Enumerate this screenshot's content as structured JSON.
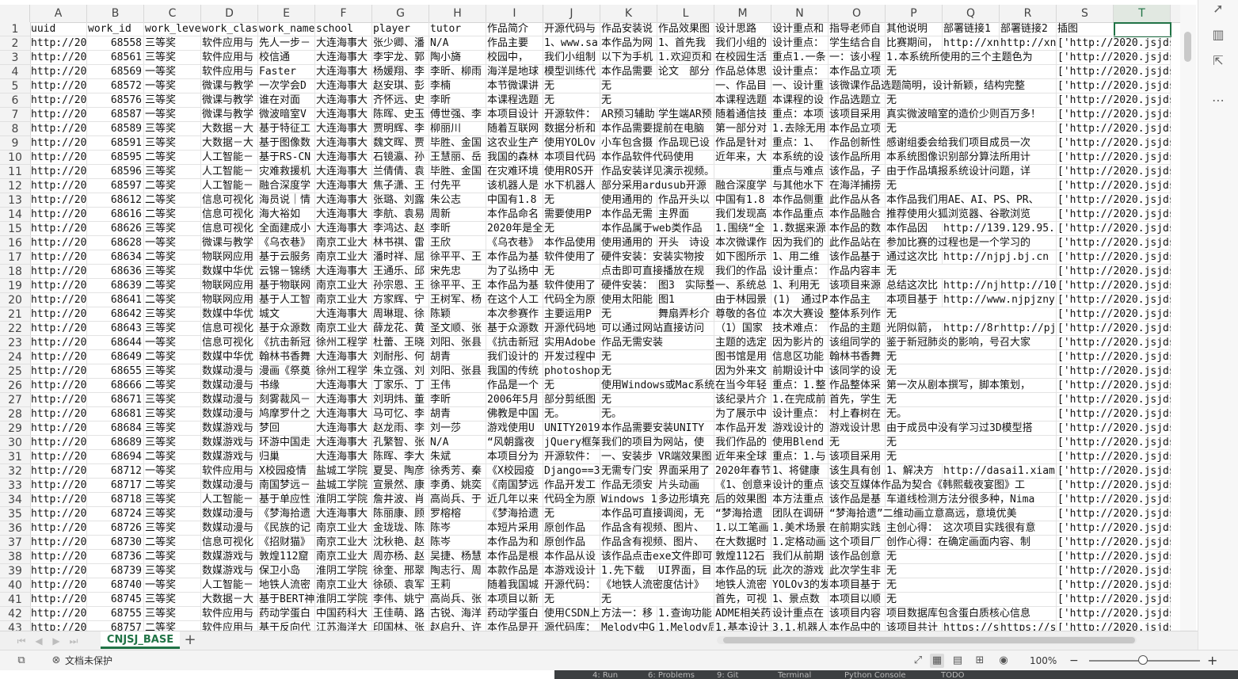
{
  "columns": [
    "A",
    "B",
    "C",
    "D",
    "E",
    "F",
    "G",
    "H",
    "I",
    "J",
    "K",
    "L",
    "M",
    "N",
    "O",
    "P",
    "Q",
    "R",
    "S",
    "T"
  ],
  "selected_column": "T",
  "row_numbers": [
    "1",
    "2",
    "3",
    "4",
    "5",
    "6",
    "7",
    "8",
    "9",
    "10",
    "11",
    "12",
    "13",
    "14",
    "15",
    "16",
    "17",
    "18",
    "19",
    "20",
    "21",
    "22",
    "23",
    "24",
    "25",
    "26",
    "27",
    "28",
    "29",
    "30",
    "31",
    "32",
    "33",
    "34",
    "35",
    "36",
    "37",
    "38",
    "39",
    "40",
    "41",
    "42",
    "43"
  ],
  "rows": [
    [
      "uuid",
      "work_id",
      "work_leve",
      "work_clas",
      "work_name",
      "school",
      "player",
      "tutor",
      "作品简介",
      "开源代码与",
      "作品安装说",
      "作品效果图",
      "设计思路",
      "设计重点和",
      "指导老师自",
      "其他说明",
      "部署链接1",
      "部署链接2",
      "插图",
      ""
    ],
    [
      "http://20",
      "68558",
      "三等奖",
      "软件应用与",
      "先人一步－",
      "大连海事大",
      "张少卿、潘",
      "N/A",
      "作品主要",
      "1、www.sa",
      "本作品为网",
      "1、首先我",
      "我们小组的",
      "设计重点：",
      "学生结合自",
      "比赛期间，",
      "http://xn",
      "http://xn",
      "['http://2020.jsjds.",
      ""
    ],
    [
      "http://20",
      "68561",
      "三等奖",
      "软件应用与",
      "校信通",
      "大连海事大",
      "李宇龙、郭",
      "陶小旖",
      "校园中，",
      "我们小组制",
      "以下为手机",
      "1.欢迎页和",
      "在校园生活",
      "重点1.一条",
      "一：该小程",
      "1.本系统所使用的三个主题色为",
      "",
      "",
      "['http://2020.jsjds.",
      ""
    ],
    [
      "http://20",
      "68569",
      "一等奖",
      "软件应用与",
      "Faster",
      "大连海事大",
      "杨媛翔、李",
      "李昕、柳雨",
      "海洋是地球",
      "模型训练代",
      "本作品需要",
      "论文　部分",
      "作品总体思",
      "设计重点：",
      "本作品立项",
      "无",
      "",
      "",
      "['http://2020.jsjds.",
      ""
    ],
    [
      "http://20",
      "68572",
      "一等奖",
      "微课与教学",
      "一次学会D",
      "大连海事大",
      "赵安琪、彭",
      "李楠",
      "本节微课讲",
      "无",
      "无",
      "",
      "一、作品目",
      "一、设计重",
      "该微课作品选题简明，设计新颖，结构完整",
      "",
      "",
      "",
      "['http://2020.jsjds.",
      ""
    ],
    [
      "http://20",
      "68576",
      "三等奖",
      "微课与教学",
      "谁在对面",
      "大连海事大",
      "齐怀远、史",
      "李昕",
      "本课程选题",
      "无",
      "无",
      "",
      "本课程选题",
      "本课程的设",
      "作品选题立",
      "无",
      "",
      "",
      "['http://2020.jsjds.",
      ""
    ],
    [
      "http://20",
      "68587",
      "一等奖",
      "微课与教学",
      "微波暗室V",
      "大连海事大",
      "陈晖、史玉",
      "傅世强、李",
      "本项目设计",
      "开源软件：",
      "AR预习辅助",
      "学生端AR预",
      "随着通信技",
      "重点：本项",
      "该项目采用",
      "真实微波暗室的造价少则百万多！",
      "",
      "",
      "['http://2020.jsjds.",
      ""
    ],
    [
      "http://20",
      "68589",
      "三等奖",
      "大数据－大",
      "基于特征工",
      "大连海事大",
      "贾明辉、李",
      "柳丽川",
      "随着互联网",
      "数据分析和",
      "本作品需要提前在电脑",
      "",
      "第一部分对",
      "1.去除无用",
      "本作品立项",
      "无",
      "",
      "",
      "['http://2020.jsjds.",
      ""
    ],
    [
      "http://20",
      "68591",
      "三等奖",
      "大数据－大",
      "基于图像数",
      "大连海事大",
      "魏文晖、贾",
      "毕胜、金国",
      "这农业生产",
      "使用YOLOv",
      "小车包含摄",
      "作品现已设",
      "作品是针对",
      "重点：1、",
      "作品创新性",
      "感谢组委会给我们项目成员一次",
      "",
      "",
      "['http://2020.jsjds.",
      ""
    ],
    [
      "http://20",
      "68595",
      "二等奖",
      "人工智能－",
      "基于RS-CN",
      "大连海事大",
      "石镜瀛、孙",
      "王慧丽、岳",
      "我国的森林",
      "本项目代码",
      "本作品软件代码使用",
      "",
      "近年来，大",
      "本系统的设",
      "该作品所用",
      "本系统图像识别部分算法所用计",
      "",
      "",
      "['http://2020.jsjds.",
      ""
    ],
    [
      "http://20",
      "68596",
      "三等奖",
      "人工智能－",
      "灾难救援机",
      "大连海事大",
      "兰倩倩、袁",
      "毕胜、金国",
      "在灾难环境",
      "使用ROS开",
      "作品安装详见演示视频。",
      "",
      "",
      "重点与难点",
      "该作品，子",
      "由于作品填报系统设计问题，详",
      "",
      "",
      "['http://2020.jsjds.",
      ""
    ],
    [
      "http://20",
      "68597",
      "二等奖",
      "人工智能－",
      "融合深度学",
      "大连海事大",
      "焦子潇、王",
      "付先平",
      "该机器人是",
      "水下机器人",
      "部分采用ardusub开源",
      "",
      "融合深度学",
      "与其他水下",
      "在海洋捕捞",
      "无",
      "",
      "",
      "['http://2020.jsjds.",
      ""
    ],
    [
      "http://20",
      "68612",
      "二等奖",
      "信息可视化",
      "海员说｜情",
      "大连海事大",
      "张璐、刘露",
      "朱公志",
      "中国有1.8",
      "无",
      "使用通用的",
      "作品开头以",
      "中国有1.8",
      "本作品侧重",
      "此作品从各",
      "本作品我们用AE、AI、PS、PR、",
      "",
      "",
      "['http://2020.jsjds.",
      ""
    ],
    [
      "http://20",
      "68616",
      "二等奖",
      "信息可视化",
      "海大裕如",
      "大连海事大",
      "李航、袁易",
      "周新",
      "本作品命名",
      "需要使用P",
      "本作品无需",
      "主界面",
      "我们发现高",
      "本作品重点",
      "本作品融合",
      "推荐使用火狐浏览器、谷歌浏览",
      "",
      "",
      "['http://2020.jsjds.",
      ""
    ],
    [
      "http://20",
      "68626",
      "三等奖",
      "信息可视化",
      "全面建成小",
      "大连海事大",
      "李鸿达、赵",
      "李昕",
      "2020年是全",
      "无",
      "本作品属于web类作品",
      "",
      "1.围绕“全",
      "1.数据来源",
      "本作品的数",
      "本作品因",
      "http://139.129.95.",
      "",
      "['http://2020.jsjds.",
      ""
    ],
    [
      "http://20",
      "68628",
      "一等奖",
      "微课与教学",
      "《乌衣巷》",
      "南京工业大",
      "林书祺、雷",
      "王欣",
      "《乌衣巷》",
      "本作品使用",
      "使用通用的",
      "开头　诗设",
      "本次微课作",
      "因为我们的",
      "此作品站在",
      "参加比赛的过程也是一个学习的",
      "",
      "",
      "['http://2020.jsjds.",
      ""
    ],
    [
      "http://20",
      "68634",
      "二等奖",
      "物联网应用",
      "基于云服务",
      "南京工业大",
      "潘时祥、屈",
      "徐平平、王",
      "本作品为基",
      "软件使用了",
      "硬件安装：安装实物按",
      "",
      "如下图所示",
      "1、用二维",
      "该作品基于",
      "通过这次比",
      "http://njpj.bj.cn",
      "",
      "['http://2020.jsjds.",
      ""
    ],
    [
      "http://20",
      "68636",
      "三等奖",
      "数媒中华优",
      "云锦－锦绣",
      "大连海事大",
      "王通乐、邱",
      "宋先忠",
      "为了弘扬中",
      "无",
      "点击即可直接播放在规",
      "",
      "我们的作品",
      "设计重点：",
      "作品内容丰",
      "无",
      "",
      "",
      "['http://2020.jsjds.",
      ""
    ],
    [
      "http://20",
      "68639",
      "二等奖",
      "物联网应用",
      "基于物联网",
      "南京工业大",
      "孙宗恩、王",
      "徐平平、王",
      "本作品为基",
      "软件使用了",
      "硬件安装：",
      "图3　实际整",
      "一、系统总",
      "1、利用无",
      "该项目来源",
      "总结这次比",
      "http://nj",
      "http://10",
      "['http://2020.jsjds.",
      ""
    ],
    [
      "http://20",
      "68641",
      "二等奖",
      "物联网应用",
      "基于人工智",
      "南京工业大",
      "方家辉、宁",
      "王树军、杨",
      "在这个人工",
      "代码全为原",
      "使用太阳能",
      "图1",
      "由于林园景",
      "(1)　通过P",
      "本作品主",
      "本项目基于",
      "http://www.njpjzny",
      "",
      "['http://2020.jsjds.",
      ""
    ],
    [
      "http://20",
      "68642",
      "三等奖",
      "数媒中华优",
      "城文",
      "大连海事大",
      "周琳琨、徐",
      "陈颖",
      "本次参赛作",
      "主要运用P",
      "无",
      "舞扇弄杉介",
      "尊敬的各位",
      "本次大赛设",
      "整体系列作",
      "无",
      "",
      "",
      "['http://2020.jsjds.",
      ""
    ],
    [
      "http://20",
      "68643",
      "三等奖",
      "信息可视化",
      "基于众源数",
      "南京工业大",
      "薛龙花、黄",
      "圣文顺、张",
      "基于众源数",
      "开源代码地",
      "可以通过网站直接访问",
      "",
      "（1）国家",
      "技术难点：",
      "作品的主题",
      "光阴似箭，",
      "http://8r",
      "http://pj",
      "['http://2020.jsjds.",
      ""
    ],
    [
      "http://20",
      "68644",
      "一等奖",
      "信息可视化",
      "《抗击新冠",
      "徐州工程学",
      "杜蕾、王晓",
      "刘阳、张县",
      "《抗击新冠",
      "实用Adobe",
      "作品无需安装",
      "",
      "主题的选定",
      "因为影片的",
      "该组同学的",
      "鉴于新冠肺炎的影响，号召大家",
      "",
      "",
      "['http://2020.jsjds.",
      ""
    ],
    [
      "http://20",
      "68649",
      "二等奖",
      "数媒中华优",
      "翰林书香舞",
      "大连海事大",
      "刘耐彤、何",
      "胡青",
      "我们设计的",
      "开发过程中",
      "无",
      "",
      "图书馆是用",
      "信息区功能",
      "翰林书香舞",
      "无",
      "",
      "",
      "['http://2020.jsjds.",
      ""
    ],
    [
      "http://20",
      "68655",
      "三等奖",
      "数媒动漫与",
      "漫画《祭奠",
      "徐州工程学",
      "朱立强、刘",
      "刘阳、张县",
      "我国的传统",
      "photoshop",
      "无",
      "",
      "因为外来文",
      "前期设计中",
      "该同学的设",
      "无",
      "",
      "",
      "['http://2020.jsjds.",
      ""
    ],
    [
      "http://20",
      "68666",
      "二等奖",
      "数媒动漫与",
      "书缘",
      "大连海事大",
      "丁家乐、丁",
      "王伟",
      "作品是一个",
      "无",
      "使用Windows或Mac系统",
      "",
      "在当今年轻",
      "重点：1.整",
      "作品整体采",
      "第一次从剧本撰写，脚本策划，",
      "",
      "",
      "['http://2020.jsjds.",
      ""
    ],
    [
      "http://20",
      "68671",
      "三等奖",
      "数媒动漫与",
      "刻雾裁风－",
      "大连海事大",
      "刘玥炜、董",
      "李昕",
      "2006年5月",
      "部分剪纸图",
      "无",
      "",
      "该纪录片介",
      "1.在完成前",
      "首先，学生",
      "无",
      "",
      "",
      "['http://2020.jsjds.",
      ""
    ],
    [
      "http://20",
      "68681",
      "三等奖",
      "数媒动漫与",
      "鸠摩罗什之",
      "大连海事大",
      "马可忆、李",
      "胡青",
      "佛教是中国",
      "无。",
      "无。",
      "",
      "为了展示中",
      "设计重点：",
      "村上春树在",
      "无。",
      "",
      "",
      "['http://2020.jsjds.",
      ""
    ],
    [
      "http://20",
      "68684",
      "三等奖",
      "数媒游戏与",
      "梦回",
      "大连海事大",
      "赵龙雨、李",
      "刘一莎",
      "游戏使用U",
      "UNITY2019",
      "本作品需要安装UNITY",
      "",
      "本作品开发",
      "游戏设计的",
      "游戏设计思",
      "由于成员中没有学习过3D模型搭",
      "",
      "",
      "['http://2020.jsjds.",
      ""
    ],
    [
      "http://20",
      "68689",
      "三等奖",
      "数媒游戏与",
      "环游中国走",
      "大连海事大",
      "孔繁智、张",
      "N/A",
      "“风朝露夜",
      "jQuery框架",
      "我们的项目为网站，使",
      "",
      "我们作品的",
      "使用Blend",
      "无",
      "无",
      "",
      "",
      "['http://2020.jsjds.",
      ""
    ],
    [
      "http://20",
      "68694",
      "二等奖",
      "数媒游戏与",
      "归巢",
      "大连海事大",
      "陈晖、李大",
      "朱斌",
      "本项目分为",
      "开源软件：",
      "一、安装步",
      "VR端效果图",
      "近年来全球",
      "重点：1.与",
      "该项目采用",
      "无",
      "",
      "",
      "['http://2020.jsjds.",
      ""
    ],
    [
      "http://20",
      "68712",
      "一等奖",
      "软件应用与",
      "X校园疫情",
      "盐城工学院",
      "夏旻、陶彦",
      "徐秀芳、秦",
      "《X校园疫",
      "Django==3",
      "无需专门安",
      "界面采用了",
      "2020年春节",
      "1、将健康",
      "该生具有创",
      "1、解决方",
      "http://dasai1.xiam",
      "",
      "['http://2020.jsjds.",
      ""
    ],
    [
      "http://20",
      "68717",
      "二等奖",
      "数媒动漫与",
      "南国梦远－",
      "盐城工学院",
      "宣景然、康",
      "李勇、姚奕",
      "《南国梦远",
      "作品开发工",
      "作品无须安",
      "片头动画",
      "《1、创意来",
      "设计的重点",
      "该交互媒体作品为契合《韩熙载夜宴图》工",
      "",
      "",
      "",
      "['http://2020.jsjds.",
      ""
    ],
    [
      "http://20",
      "68718",
      "三等奖",
      "人工智能－",
      "基于单应性",
      "淮阴工学院",
      "詹井波、肖",
      "高尚兵、于",
      "近几年以来",
      "代码全为原",
      "Windows 1",
      "多边形填充",
      "后的效果图",
      "本方法重点",
      "该作品是基",
      "车道线检测方法分很多种，Nima",
      "",
      "",
      "['http://2020.jsjds.",
      ""
    ],
    [
      "http://20",
      "68724",
      "三等奖",
      "数媒动漫与",
      "《梦海拾遗",
      "大连海事大",
      "陈丽康、顾",
      "罗榕榕",
      "《梦海拾遗",
      "无",
      "本作品可直接调阅，无",
      "",
      "“梦海拾遗",
      "团队在调研",
      "“梦海拾遗”二维动画立意高远，意境优美",
      "",
      "",
      "",
      "['http://2020.jsjds.",
      ""
    ],
    [
      "http://20",
      "68726",
      "三等奖",
      "数媒动漫与",
      "《民族的记",
      "南京工业大",
      "金珑珑、陈",
      "陈岑",
      "本短片采用",
      "原创作品",
      "作品含有视频、图片、",
      "",
      "1.以工笔画",
      "1.美术场景",
      "在前期实践",
      "主创心得：　这次项目实践很有意",
      "",
      "",
      "['http://2020.jsjds.",
      ""
    ],
    [
      "http://20",
      "68730",
      "二等奖",
      "信息可视化",
      "《招财猫》",
      "南京工业大",
      "沈秋艳、赵",
      "陈岑",
      "本作品为和",
      "原创作品",
      "作品含有视频、图片、",
      "",
      "在大数据时",
      "1.定格动画",
      "这个项目厂",
      "创作心得：在确定画面内容、制",
      "",
      "",
      "['http://2020.jsjds.",
      ""
    ],
    [
      "http://20",
      "68736",
      "二等奖",
      "数媒游戏与",
      "敦煌112窟",
      "南京工业大",
      "周亦杨、赵",
      "吴捷、杨慧",
      "本作品是根",
      "本作品从设",
      "该作品点击exe文件即可",
      "",
      "敦煌112石",
      "我们从前期",
      "该作品创意",
      "无",
      "",
      "",
      "['http://2020.jsjds.",
      ""
    ],
    [
      "http://20",
      "68739",
      "三等奖",
      "数媒游戏与",
      "保卫小岛",
      "淮阴工学院",
      "徐奎、邢翠",
      "陶志行、周",
      "本款作品是",
      "本游戏设计",
      "1.先下载",
      "UI界面，目",
      "本作品的玩",
      "此次的游戏",
      "此次学生非",
      "无",
      "",
      "",
      "['http://2020.jsjds.",
      ""
    ],
    [
      "http://20",
      "68740",
      "一等奖",
      "人工智能－",
      "地铁人流密",
      "南京工业大",
      "徐硕、袁军",
      "王莉",
      "随着我国城",
      "开源代码：",
      "《地铁人流密度估计》",
      "",
      "地铁人流密",
      "YOLOv3的发",
      "本项目基于",
      "无",
      "",
      "",
      "['http://2020.jsjds.",
      ""
    ],
    [
      "http://20",
      "68745",
      "三等奖",
      "大数据－大",
      "基于BERT神",
      "淮阴工学院",
      "李伟、姚宁",
      "高尚兵、张",
      "本项目以新",
      "无",
      "无",
      "",
      "首先，可视",
      "1、景点数",
      "本项目以顺",
      "无",
      "",
      "",
      "['http://2020.jsjds.",
      ""
    ],
    [
      "http://20",
      "68755",
      "三等奖",
      "软件应用与",
      "药动学蛋白",
      "中国药科大",
      "王佳萌、路",
      "古锐、海洋",
      "药动学蛋白",
      "使用CSDN上",
      "方法一：移",
      "1.查询功能",
      "ADME相关药",
      "设计重点在",
      "该项目内容",
      "项目数据库包含蛋白质核心信息",
      "",
      "",
      "['http://2020.jsjds.",
      ""
    ],
    [
      "http://20",
      "68757",
      "二等奖",
      "软件应用与",
      "基于反向代",
      "江苏海洋大",
      "印国林、张",
      "赵启升、许",
      "本作品是开",
      "源代码库：",
      "Melody中G",
      "1.Melody后",
      "1.基本设计",
      "3.1.机器人",
      "本作品中的",
      "该项目共计",
      "https://s",
      "https://s",
      "['http://2020.jsjds.",
      ""
    ]
  ],
  "sheet_nav": {
    "first_icon": "⏮",
    "prev_icon": "◀",
    "next_icon": "▶",
    "last_icon": "⏭"
  },
  "sheet_tab": "CNJSJ_BASE",
  "add_sheet": "+",
  "status": {
    "doc_protect": "文档未保护",
    "zoom": "100%",
    "zoom_minus": "−",
    "zoom_plus": "+"
  },
  "ide_tabs": [
    "4: Run",
    "6: Problems",
    "9: Git",
    "Terminal",
    "Python Console",
    "TODO"
  ],
  "colors": {
    "accent": "#217346",
    "grid": "#e3e3e3",
    "ide_bg": "#3c3f41"
  }
}
